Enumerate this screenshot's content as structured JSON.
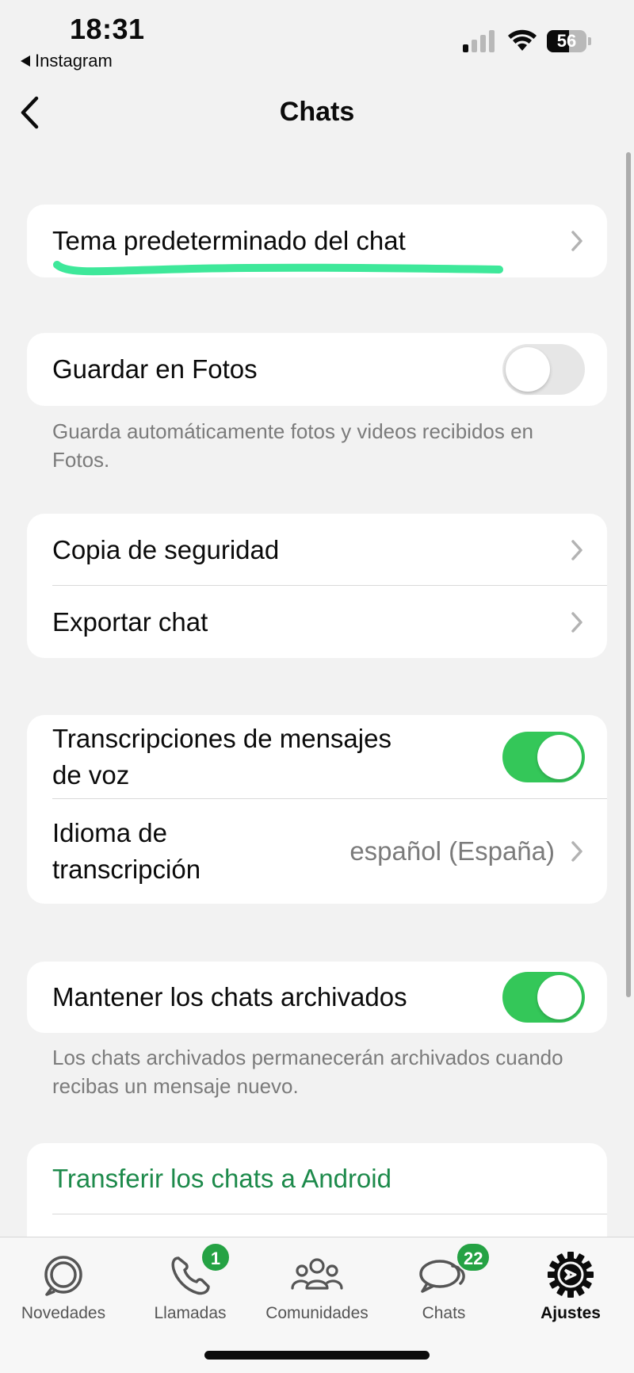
{
  "status_bar": {
    "time": "18:31",
    "back_app": "Instagram",
    "battery": "56",
    "battery_level": 0.56
  },
  "nav": {
    "title": "Chats"
  },
  "sections": {
    "theme": {
      "label": "Tema predeterminado del chat"
    },
    "save_photos": {
      "label": "Guardar en Fotos",
      "enabled": false,
      "footer": "Guarda automáticamente fotos y videos recibidos en Fotos."
    },
    "backup": {
      "backup_label": "Copia de seguridad",
      "export_label": "Exportar chat"
    },
    "transcription": {
      "label_line1": "Transcripciones de mensajes",
      "label_line2": "de voz",
      "enabled": true,
      "language_line1": "Idioma de",
      "language_line2": "transcripción",
      "language_value": "español (España)"
    },
    "archived": {
      "label": "Mantener los chats archivados",
      "enabled": true,
      "footer": "Los chats archivados permanecerán archivados cuando recibas un mensaje nuevo."
    },
    "transfer": {
      "label": "Transferir los chats a Android"
    }
  },
  "colors": {
    "accent_green": "#34c759",
    "link_green": "#1d8a4b",
    "highlight": "#3ee89a",
    "badge_green": "#25a244"
  },
  "tabbar": {
    "tabs": [
      {
        "label": "Novedades",
        "icon": "updates-icon",
        "badge": null
      },
      {
        "label": "Llamadas",
        "icon": "phone-icon",
        "badge": "1"
      },
      {
        "label": "Comunidades",
        "icon": "communities-icon",
        "badge": null
      },
      {
        "label": "Chats",
        "icon": "chat-bubbles-icon",
        "badge": "22"
      },
      {
        "label": "Ajustes",
        "icon": "gear-icon",
        "badge": null,
        "active": true
      }
    ]
  }
}
